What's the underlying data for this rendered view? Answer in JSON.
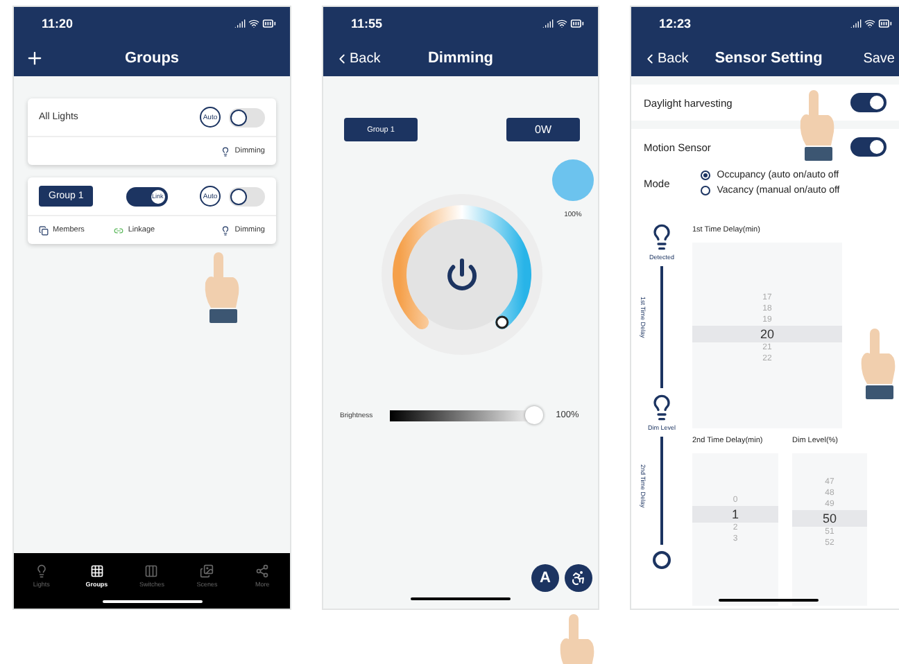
{
  "groups_screen": {
    "status_time": "11:20",
    "title": "Groups",
    "cards": [
      {
        "kind": "all",
        "name": "All Lights",
        "auto_label": "Auto",
        "on": false,
        "actions": [
          {
            "kind": "dimming",
            "label": "Dimming"
          }
        ]
      },
      {
        "kind": "group",
        "name": "Group 1",
        "link_label": "Link",
        "linked": true,
        "auto_label": "Auto",
        "on": false,
        "actions": [
          {
            "kind": "members",
            "label": "Members"
          },
          {
            "kind": "linkage",
            "label": "Linkage"
          },
          {
            "kind": "dimming",
            "label": "Dimming"
          }
        ]
      }
    ],
    "tabs": [
      {
        "label": "Lights",
        "selected": false
      },
      {
        "label": "Groups",
        "selected": true
      },
      {
        "label": "Switches",
        "selected": false
      },
      {
        "label": "Scenes",
        "selected": false
      },
      {
        "label": "More",
        "selected": false
      }
    ]
  },
  "dimming_screen": {
    "status_time": "11:55",
    "back": "Back",
    "title": "Dimming",
    "group_label": "Group 1",
    "power_reading": "0W",
    "swatch_reading": "100%",
    "brightness": {
      "label": "Brightness",
      "level": 1,
      "reading": "100%"
    },
    "auto_button": "A"
  },
  "sensor_screen": {
    "status_time": "12:23",
    "back": "Back",
    "title": "Sensor Setting",
    "save": "Save",
    "settings": [
      {
        "label": "Daylight harvesting",
        "on": true
      },
      {
        "label": "Motion Sensor",
        "on": true
      }
    ],
    "mode_label": "Mode",
    "modes": [
      {
        "label": "Occupancy (auto on/auto off",
        "selected": true
      },
      {
        "label": "Vacancy (manual on/auto off",
        "selected": false
      }
    ],
    "timeline": {
      "detected": "Detected",
      "first_delay": "1st Time Delay",
      "dim_level": "Dim Level",
      "second_delay": "2nd Time Delay"
    },
    "pickers": [
      {
        "title": "1st Time Delay(min)",
        "values": [
          {
            "label": "17",
            "selected": false
          },
          {
            "label": "18",
            "selected": false
          },
          {
            "label": "19",
            "selected": false
          },
          {
            "label": "20",
            "selected": true
          },
          {
            "label": "21",
            "selected": false
          },
          {
            "label": "22",
            "selected": false
          }
        ]
      },
      {
        "title": "2nd Time Delay(min)",
        "values": [
          {
            "label": "0",
            "selected": false
          },
          {
            "label": "1",
            "selected": true
          },
          {
            "label": "2",
            "selected": false
          },
          {
            "label": "3",
            "selected": false
          }
        ]
      },
      {
        "title": "Dim Level(%)",
        "values": [
          {
            "label": "47",
            "selected": false
          },
          {
            "label": "48",
            "selected": false
          },
          {
            "label": "49",
            "selected": false
          },
          {
            "label": "50",
            "selected": true
          },
          {
            "label": "51",
            "selected": false
          },
          {
            "label": "52",
            "selected": false
          }
        ]
      }
    ]
  }
}
